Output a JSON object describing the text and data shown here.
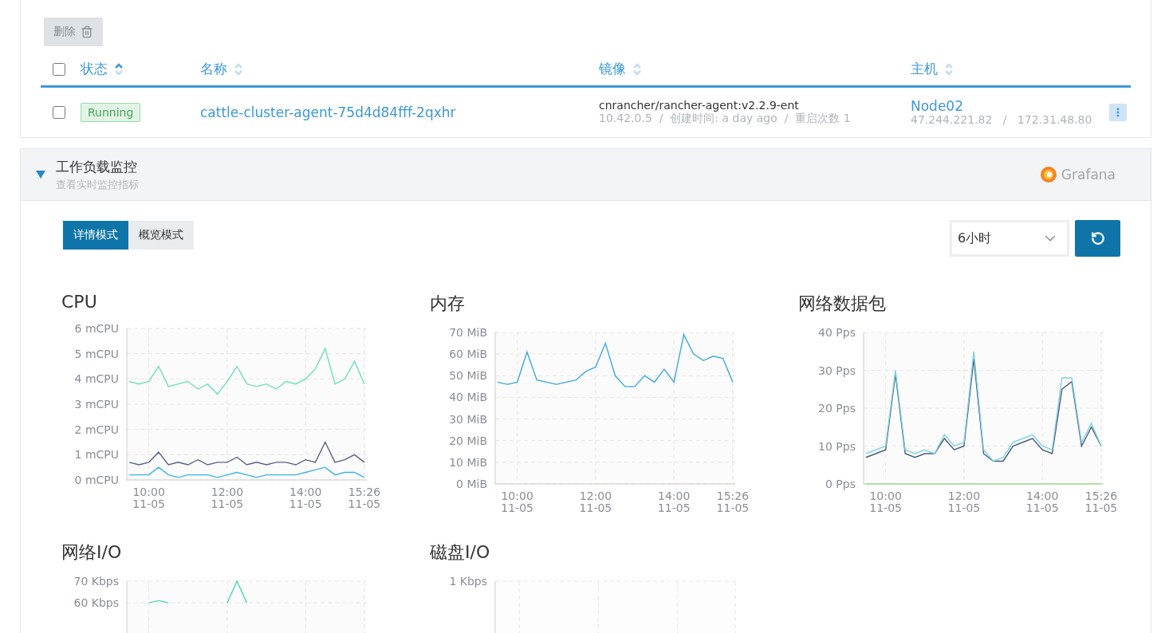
{
  "toolbar": {
    "delete_button": "删除"
  },
  "table": {
    "select_all": {
      "checked": false
    },
    "columns": [
      {
        "label": "状态",
        "sorted": true
      },
      {
        "label": "名称",
        "sorted": false
      },
      {
        "label": "镜像",
        "sorted": false
      },
      {
        "label": "主机",
        "sorted": false
      }
    ],
    "rows": [
      {
        "checked": false,
        "status": "Running",
        "name": "cattle-cluster-agent-75d4d84fff-2qxhr",
        "image": "cnrancher/rancher-agent:v2.2.9-ent",
        "image_detail": "10.42.0.5  /  创建时间: a day ago  /  重启次数 1",
        "host": "Node02",
        "host_ips": "47.244.221.82   /   172.31.48.80"
      }
    ]
  },
  "monitoring": {
    "expanded": true,
    "title": "工作负载监控",
    "subtitle": "查看实时监控指标",
    "provider": "Grafana",
    "modes": [
      {
        "label": "详情模式",
        "selected": true
      },
      {
        "label": "概览模式",
        "selected": false
      }
    ],
    "range": {
      "value": "6小时"
    },
    "charts": [
      {
        "title": "CPU",
        "chart_data": {
          "type": "line",
          "grid": true,
          "categories": [
            null,
            null,
            "10:00 11-05",
            null,
            null,
            null,
            null,
            null,
            null,
            null,
            "12:00 11-05",
            null,
            null,
            null,
            null,
            null,
            null,
            null,
            "14:00 11-05",
            null,
            null,
            null,
            null,
            null,
            "15:26 11-05"
          ],
          "ylim": [
            0,
            6
          ],
          "yticks": [
            {
              "value": 0,
              "label": "0 mCPU"
            },
            {
              "value": 1,
              "label": "1 mCPU"
            },
            {
              "value": 2,
              "label": "2 mCPU"
            },
            {
              "value": 3,
              "label": "3 mCPU"
            },
            {
              "value": 4,
              "label": "4 mCPU"
            },
            {
              "value": 5,
              "label": "5 mCPU"
            },
            {
              "value": 6,
              "label": "6 mCPU"
            }
          ],
          "series": [
            {
              "color": "#6ee0b8",
              "values": [
                3.9,
                3.8,
                3.9,
                4.5,
                3.7,
                3.8,
                3.9,
                3.6,
                3.8,
                3.4,
                3.9,
                4.5,
                3.8,
                3.7,
                3.8,
                3.6,
                3.9,
                3.8,
                4.0,
                4.4,
                5.2,
                3.8,
                4.0,
                4.7,
                3.8
              ]
            },
            {
              "color": "#5b6088",
              "values": [
                0.7,
                0.6,
                0.7,
                1.1,
                0.6,
                0.7,
                0.6,
                0.8,
                0.6,
                0.7,
                0.7,
                0.9,
                0.6,
                0.7,
                0.6,
                0.7,
                0.7,
                0.6,
                0.8,
                0.7,
                1.5,
                0.7,
                0.8,
                1.0,
                0.7
              ]
            },
            {
              "color": "#3cb4e6",
              "values": [
                0.2,
                0.2,
                0.2,
                0.5,
                0.2,
                0.1,
                0.2,
                0.2,
                0.2,
                0.1,
                0.2,
                0.3,
                0.2,
                0.1,
                0.2,
                0.2,
                0.2,
                0.2,
                0.3,
                0.4,
                0.5,
                0.2,
                0.3,
                0.3,
                0.1
              ]
            }
          ]
        }
      },
      {
        "title": "内存",
        "chart_data": {
          "type": "line",
          "grid": true,
          "categories": [
            null,
            null,
            "10:00 11-05",
            null,
            null,
            null,
            null,
            null,
            null,
            null,
            "12:00 11-05",
            null,
            null,
            null,
            null,
            null,
            null,
            null,
            "14:00 11-05",
            null,
            null,
            null,
            null,
            null,
            "15:26 11-05"
          ],
          "ylim": [
            0,
            70
          ],
          "yticks": [
            {
              "value": 0,
              "label": "0 MiB"
            },
            {
              "value": 10,
              "label": "10 MiB"
            },
            {
              "value": 20,
              "label": "20 MiB"
            },
            {
              "value": 30,
              "label": "30 MiB"
            },
            {
              "value": 40,
              "label": "40 MiB"
            },
            {
              "value": 50,
              "label": "50 MiB"
            },
            {
              "value": 60,
              "label": "60 MiB"
            },
            {
              "value": 70,
              "label": "70 MiB"
            }
          ],
          "series": [
            {
              "color": "#3ca9e0",
              "values": [
                47,
                46,
                47,
                61,
                48,
                47,
                46,
                47,
                48,
                52,
                54,
                65,
                50,
                45,
                45,
                50,
                47,
                53,
                47,
                69,
                60,
                57,
                59,
                58,
                47
              ]
            }
          ]
        }
      },
      {
        "title": "网络数据包",
        "chart_data": {
          "type": "line",
          "grid": true,
          "categories": [
            null,
            null,
            "10:00 11-05",
            null,
            null,
            null,
            null,
            null,
            null,
            null,
            "12:00 11-05",
            null,
            null,
            null,
            null,
            null,
            null,
            null,
            "14:00 11-05",
            null,
            null,
            null,
            null,
            null,
            "15:26 11-05"
          ],
          "ylim": [
            0,
            40
          ],
          "yticks": [
            {
              "value": 0,
              "label": "0 Pps"
            },
            {
              "value": 10,
              "label": "10 Pps"
            },
            {
              "value": 20,
              "label": "20 Pps"
            },
            {
              "value": 30,
              "label": "30 Pps"
            },
            {
              "value": 40,
              "label": "40 Pps"
            }
          ],
          "series": [
            {
              "color": "#a6d99a",
              "values": [
                0,
                0,
                0,
                0,
                0,
                0,
                0,
                0,
                0,
                0,
                0,
                0,
                0,
                0,
                0,
                0,
                0,
                0,
                0,
                0,
                0,
                0,
                0,
                0,
                0
              ]
            },
            {
              "color": "#4a5a7a",
              "values": [
                7,
                8,
                9,
                29,
                8,
                7,
                8,
                8,
                12,
                9,
                10,
                33,
                8,
                6,
                6,
                10,
                11,
                12,
                9,
                8,
                25,
                27,
                10,
                15,
                10
              ]
            },
            {
              "color": "#7fd3e0",
              "values": [
                8,
                9,
                10,
                30,
                9,
                8,
                9,
                8,
                13,
                10,
                11,
                35,
                9,
                6,
                7,
                11,
                12,
                13,
                10,
                9,
                28,
                28,
                11,
                16,
                10
              ]
            }
          ]
        }
      },
      {
        "title": "网络I/O",
        "chart_data": {
          "type": "line",
          "grid": true,
          "categories": [
            null,
            null,
            null,
            null,
            null,
            null,
            null,
            null,
            null,
            null,
            null,
            null,
            null,
            null,
            null,
            null,
            null,
            null,
            null,
            null,
            null,
            null,
            null,
            null,
            null
          ],
          "ylim": [
            0,
            70
          ],
          "yticks": [
            {
              "value": 60,
              "label": "60 Kbps"
            },
            {
              "value": 70,
              "label": "70 Kbps"
            }
          ],
          "series": [
            {
              "color": "#4fd8b8",
              "values": [
                null,
                null,
                60,
                61,
                60,
                null,
                null,
                null,
                null,
                null,
                60,
                70,
                60,
                null,
                null,
                null,
                null,
                null,
                null,
                null,
                null,
                null,
                null,
                null,
                null
              ]
            }
          ]
        }
      },
      {
        "title": "磁盘I/O",
        "chart_data": {
          "type": "other",
          "annotations": [
            "1 Kbps"
          ]
        }
      }
    ]
  }
}
